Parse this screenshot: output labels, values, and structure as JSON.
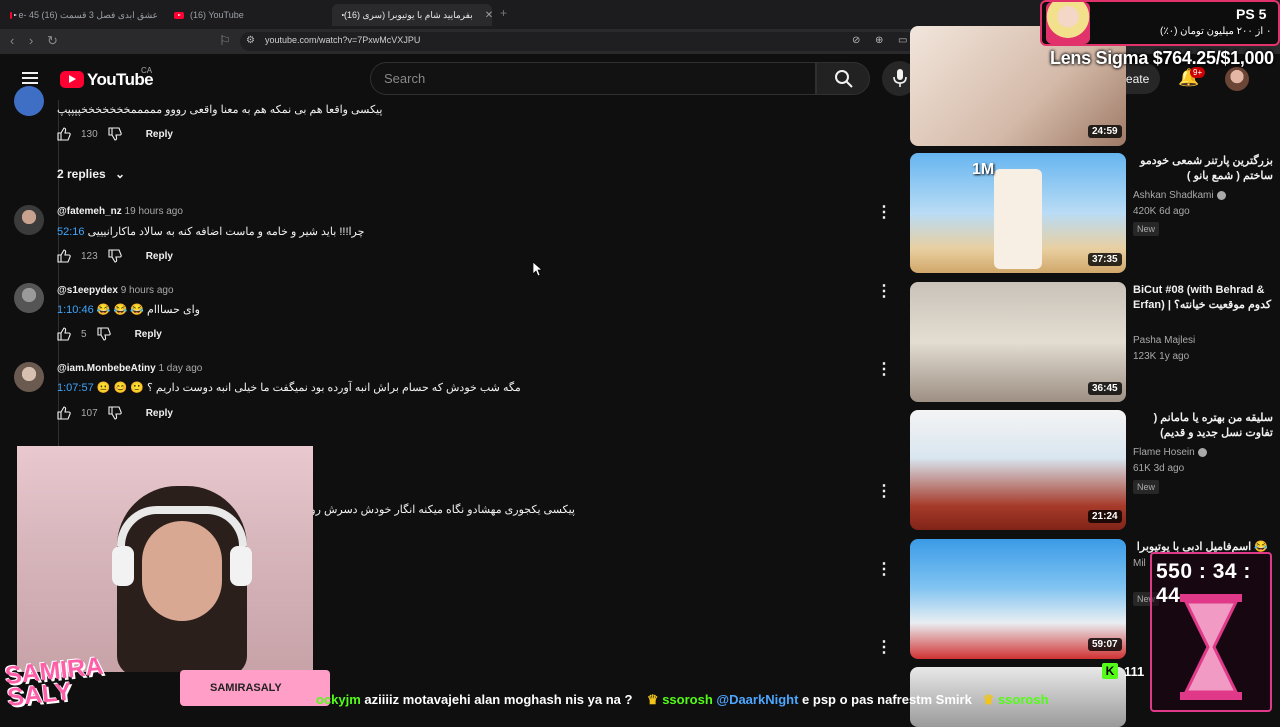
{
  "browser": {
    "tabs": [
      {
        "label": "e- 45 عشق ابدی فصل 3 قسمت (16)",
        "active": false
      },
      {
        "label": "(16) YouTube",
        "active": false
      },
      {
        "label": "(16) بفرمایید شام با یوتیوبرا (سری",
        "active": true
      }
    ],
    "url": "youtube.com/watch?v=7PxwMcVXJPU"
  },
  "header": {
    "logo": "YouTube",
    "country": "CA",
    "search_placeholder": "Search",
    "create_label": "Create",
    "notif_count": "9+"
  },
  "comments": {
    "first": {
      "text": "پیکسی واقعا هم بی نمکه هم به معنا واقعی رووو مممممخخخخخخخپپپپپ",
      "likes": "130",
      "reply": "Reply"
    },
    "replies_toggle": "2 replies",
    "items": [
      {
        "handle": "@fatemeh_nz",
        "time": "19 hours ago",
        "ts": "52:16",
        "text": "چرا!!! باید شیر و خامه و ماست اضافه کنه به سالاد ماکارانیییی",
        "likes": "123",
        "reply": "Reply"
      },
      {
        "handle": "@s1eepydex",
        "time": "9 hours ago",
        "ts": "1:10:46",
        "text": "وای حسااام 😂 😂 😂",
        "likes": "5",
        "reply": "Reply"
      },
      {
        "handle": "@iam.MonbebeAtiny",
        "time": "1 day ago",
        "ts": "1:07:57",
        "text": "مگه شب خودش که حسام براش انبه آورده بود نمیگفت ما خیلی انبه دوست داریم ؟ 🙂 😊 😐",
        "likes": "107",
        "reply": "Reply"
      },
      {
        "text": "پیکسی یکجوری مهشادو نگاه میکنه انگار خودش دسرش رو درست کرده"
      }
    ]
  },
  "related": [
    {
      "title": "",
      "channel": "",
      "stats": "",
      "duration": "24:59"
    },
    {
      "title": "بزرگترین پارتنر شمعی خودمو ساختم ( شمع بانو )",
      "channel": "Ashkan Shadkami",
      "stats": "420K  6d ago",
      "badge": "New",
      "duration": "37:35",
      "overlay": "1M"
    },
    {
      "title": "BiCut #08 (with Behrad & Erfan) | کدوم موقعیت خیانته؟",
      "channel": "Pasha Majlesi",
      "stats": "123K  1y ago",
      "duration": "36:45"
    },
    {
      "title": "سلیقه من بهتره یا مامانم ( تفاوت نسل جدید و قدیم)",
      "channel": "Flame Hosein",
      "stats": "61K  3d ago",
      "badge": "New",
      "duration": "21:24"
    },
    {
      "title": "😂 اسم‌فامیل ادبی با یوتیوبرا",
      "channel": "Mil",
      "stats": "",
      "badge": "New",
      "duration": "59:07"
    }
  ],
  "overlay": {
    "ps5_label": "PS 5",
    "ps5_sub": "۰ از ۲۰۰ میلیون تومان (۰٪)",
    "goal": "Lens Sigma $764.25/$1,000",
    "timer": "550 : 34 : 44",
    "kick_count": "111",
    "kick_letter": "K",
    "streamer": "SAMIRA SALY",
    "social": "SAMIRASALY",
    "chat": [
      {
        "user": "ockyjm",
        "msg": " aziiiiz motavajehi alan moghash nis ya na ?"
      },
      {
        "user": "ssorosh",
        "mention": "@DaarkNight",
        "msg": " e psp o pas nafrestm Smirk"
      },
      {
        "user": "ssorosh",
        "msg": ""
      }
    ]
  },
  "colors": {
    "accent": "#ff0033",
    "link": "#3ea6ff",
    "overlay_pink": "#e2326b",
    "kick_green": "#53fc18"
  }
}
